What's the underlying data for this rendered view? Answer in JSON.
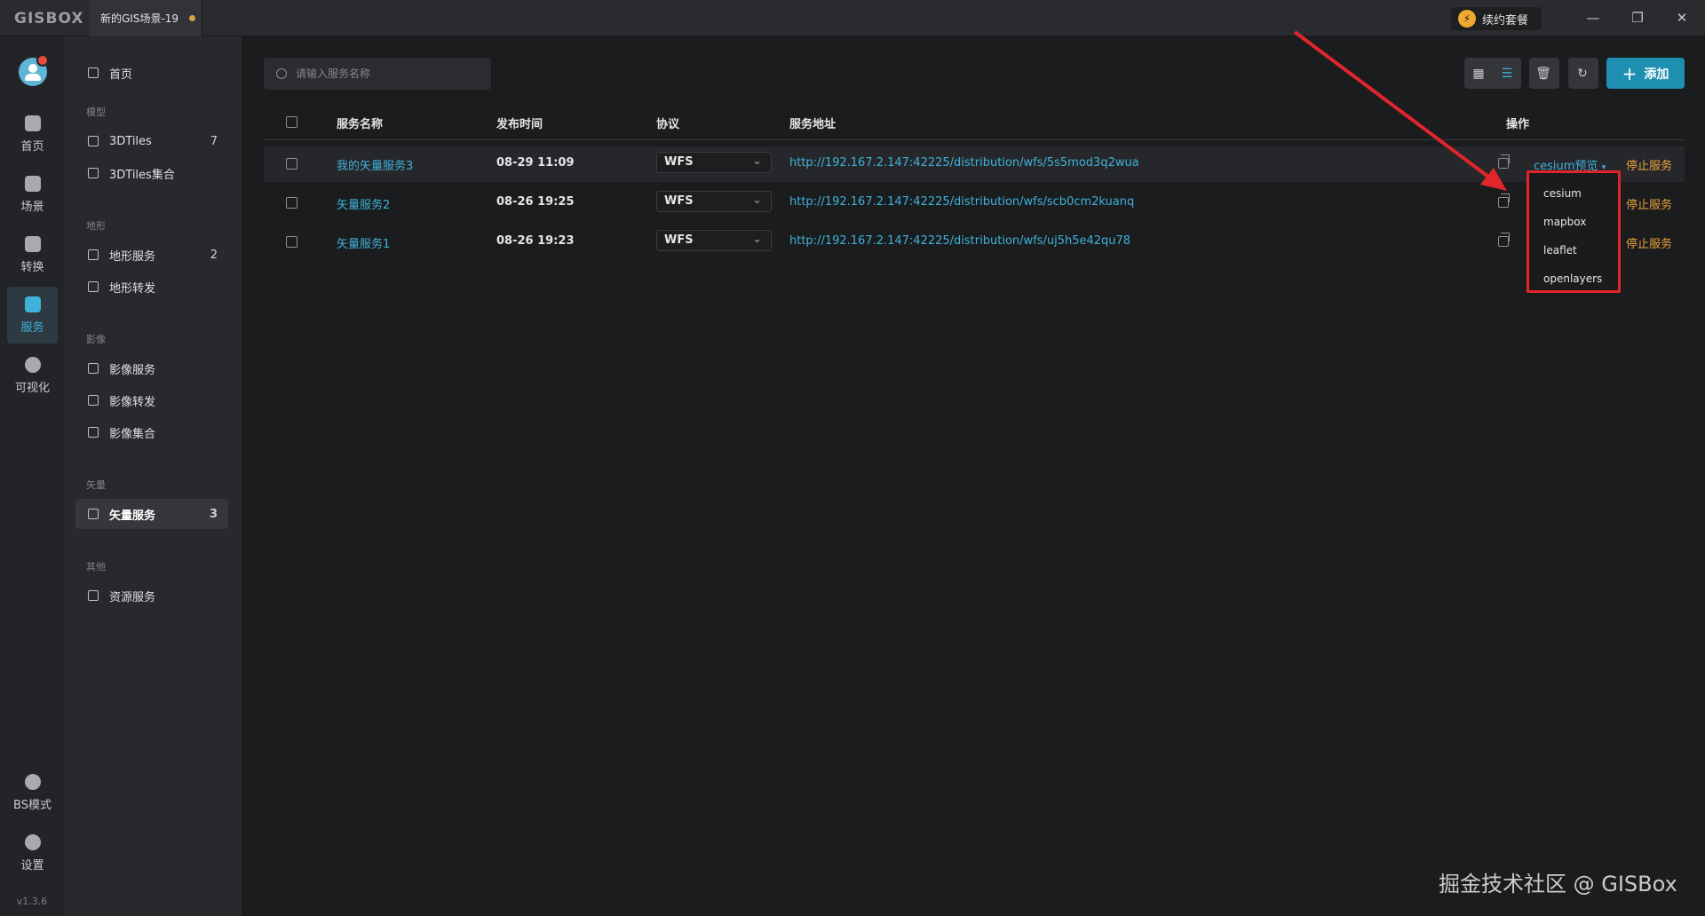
{
  "titlebar": {
    "logo": "GISBOX",
    "tab_title": "新的GIS场景-19",
    "renew_label": "续约套餐"
  },
  "rail": {
    "items": [
      {
        "label": "首页"
      },
      {
        "label": "场景"
      },
      {
        "label": "转换"
      },
      {
        "label": "服务"
      },
      {
        "label": "可视化"
      }
    ],
    "bs_mode": "BS模式",
    "settings": "设置",
    "version": "v1.3.6"
  },
  "sidebar": {
    "home": "首页",
    "groups": {
      "model": "模型",
      "terrain": "地形",
      "image": "影像",
      "vector": "矢量",
      "other": "其他"
    },
    "items": {
      "tiles": {
        "label": "3DTiles",
        "count": "7"
      },
      "tiles_set": {
        "label": "3DTiles集合"
      },
      "terrain_service": {
        "label": "地形服务",
        "count": "2"
      },
      "terrain_forward": {
        "label": "地形转发"
      },
      "image_service": {
        "label": "影像服务"
      },
      "image_forward": {
        "label": "影像转发"
      },
      "image_set": {
        "label": "影像集合"
      },
      "vector_service": {
        "label": "矢量服务",
        "count": "3"
      },
      "resource_service": {
        "label": "资源服务"
      }
    }
  },
  "main": {
    "search_placeholder": "请输入服务名称",
    "add_label": "添加",
    "columns": {
      "name": "服务名称",
      "time": "发布时间",
      "protocol": "协议",
      "url": "服务地址",
      "ops": "操作"
    },
    "rows": [
      {
        "name": "我的矢量服务3",
        "time": "08-29 11:09",
        "protocol": "WFS",
        "url": "http://192.167.2.147:42225/distribution/wfs/5s5mod3q2wua",
        "preview": "cesium预览",
        "stop": "停止服务"
      },
      {
        "name": "矢量服务2",
        "time": "08-26 19:25",
        "protocol": "WFS",
        "url": "http://192.167.2.147:42225/distribution/wfs/scb0cm2kuanq",
        "stop": "停止服务"
      },
      {
        "name": "矢量服务1",
        "time": "08-26 19:23",
        "protocol": "WFS",
        "url": "http://192.167.2.147:42225/distribution/wfs/uj5h5e42qu78",
        "stop": "停止服务"
      }
    ],
    "preview_options": [
      "cesium",
      "mapbox",
      "leaflet",
      "openlayers"
    ]
  },
  "watermark": "掘金技术社区 @ GISBox",
  "colors": {
    "accent": "#3fb2d9",
    "stop": "#e8a23a",
    "highlight_box": "#e0262b",
    "add_button": "#1e8fb0"
  }
}
